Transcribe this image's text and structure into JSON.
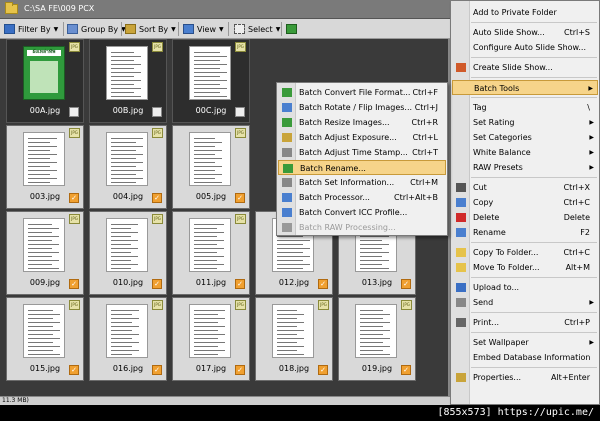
{
  "path": "C:\\SA FE\\009 PCX",
  "toolbar": {
    "filter_by": "Filter By",
    "group_by": "Group By",
    "sort_by": "Sort By",
    "view": "View",
    "select": "Select"
  },
  "thumbnails": [
    {
      "name": "00A.jpg",
      "selected": true,
      "cover": true,
      "checked": false
    },
    {
      "name": "00B.jpg",
      "selected": true,
      "cover": false,
      "checked": false
    },
    {
      "name": "00C.jpg",
      "selected": true,
      "cover": false,
      "checked": false
    },
    {
      "name": "003.jpg",
      "selected": false,
      "cover": false,
      "checked": true
    },
    {
      "name": "004.jpg",
      "selected": false,
      "cover": false,
      "checked": true
    },
    {
      "name": "005.jpg",
      "selected": false,
      "cover": false,
      "checked": true
    },
    {
      "name": "009.jpg",
      "selected": false,
      "cover": false,
      "checked": true
    },
    {
      "name": "010.jpg",
      "selected": false,
      "cover": false,
      "checked": true
    },
    {
      "name": "011.jpg",
      "selected": false,
      "cover": false,
      "checked": true
    },
    {
      "name": "012.jpg",
      "selected": false,
      "cover": false,
      "checked": true
    },
    {
      "name": "013.jpg",
      "selected": false,
      "cover": false,
      "checked": true
    },
    {
      "name": "015.jpg",
      "selected": false,
      "cover": false,
      "checked": true
    },
    {
      "name": "016.jpg",
      "selected": false,
      "cover": false,
      "checked": true
    },
    {
      "name": "017.jpg",
      "selected": false,
      "cover": false,
      "checked": true
    },
    {
      "name": "018.jpg",
      "selected": false,
      "cover": false,
      "checked": true
    },
    {
      "name": "019.jpg",
      "selected": false,
      "cover": false,
      "checked": true
    }
  ],
  "cover_title": "ผังเหล่าทัพ",
  "jpg_badge": "JPG",
  "status": "11.3 MB)",
  "watermark": "[855x573] https://upic.me/",
  "context_menu": [
    {
      "label": "Add to Private Folder",
      "shortcut": "",
      "icon": "",
      "submenu": false,
      "sep_after": true
    },
    {
      "label": "Auto Slide Show...",
      "shortcut": "Ctrl+S",
      "icon": "",
      "submenu": false,
      "sep_after": false
    },
    {
      "label": "Configure Auto Slide Show...",
      "shortcut": "",
      "icon": "",
      "submenu": false,
      "sep_after": true
    },
    {
      "label": "Create Slide Show...",
      "shortcut": "",
      "icon": "slideshow-icon",
      "submenu": false,
      "sep_after": true
    },
    {
      "label": "Batch Tools",
      "shortcut": "",
      "icon": "",
      "submenu": true,
      "sep_after": true,
      "highlight": true
    },
    {
      "label": "Tag",
      "shortcut": "\\",
      "icon": "",
      "submenu": false,
      "sep_after": false
    },
    {
      "label": "Set Rating",
      "shortcut": "",
      "icon": "",
      "submenu": true,
      "sep_after": false
    },
    {
      "label": "Set Categories",
      "shortcut": "",
      "icon": "",
      "submenu": true,
      "sep_after": false
    },
    {
      "label": "White Balance",
      "shortcut": "",
      "icon": "",
      "submenu": true,
      "sep_after": false
    },
    {
      "label": "RAW Presets",
      "shortcut": "",
      "icon": "",
      "submenu": true,
      "sep_after": true
    },
    {
      "label": "Cut",
      "shortcut": "Ctrl+X",
      "icon": "cut-icon",
      "submenu": false,
      "sep_after": false
    },
    {
      "label": "Copy",
      "shortcut": "Ctrl+C",
      "icon": "copy-icon",
      "submenu": false,
      "sep_after": false
    },
    {
      "label": "Delete",
      "shortcut": "Delete",
      "icon": "delete-icon",
      "submenu": false,
      "sep_after": false
    },
    {
      "label": "Rename",
      "shortcut": "F2",
      "icon": "rename-icon",
      "submenu": false,
      "sep_after": true
    },
    {
      "label": "Copy To Folder...",
      "shortcut": "Ctrl+C",
      "icon": "copy-folder-icon",
      "submenu": false,
      "sep_after": false
    },
    {
      "label": "Move To Folder...",
      "shortcut": "Alt+M",
      "icon": "move-folder-icon",
      "submenu": false,
      "sep_after": true
    },
    {
      "label": "Upload to...",
      "shortcut": "",
      "icon": "upload-icon",
      "submenu": false,
      "sep_after": false
    },
    {
      "label": "Send",
      "shortcut": "",
      "icon": "send-icon",
      "submenu": true,
      "sep_after": true
    },
    {
      "label": "Print...",
      "shortcut": "Ctrl+P",
      "icon": "print-icon",
      "submenu": false,
      "sep_after": true
    },
    {
      "label": "Set Wallpaper",
      "shortcut": "",
      "icon": "",
      "submenu": true,
      "sep_after": false
    },
    {
      "label": "Embed Database Information",
      "shortcut": "",
      "icon": "",
      "submenu": false,
      "sep_after": true
    },
    {
      "label": "Properties...",
      "shortcut": "Alt+Enter",
      "icon": "properties-icon",
      "submenu": false,
      "sep_after": false
    }
  ],
  "batch_menu": [
    {
      "label": "Batch Convert File Format...",
      "shortcut": "Ctrl+F",
      "disabled": false,
      "highlight": false
    },
    {
      "label": "Batch Rotate / Flip Images...",
      "shortcut": "Ctrl+J",
      "disabled": false,
      "highlight": false
    },
    {
      "label": "Batch Resize Images...",
      "shortcut": "Ctrl+R",
      "disabled": false,
      "highlight": false
    },
    {
      "label": "Batch Adjust Exposure...",
      "shortcut": "Ctrl+L",
      "disabled": false,
      "highlight": false
    },
    {
      "label": "Batch Adjust Time Stamp...",
      "shortcut": "Ctrl+T",
      "disabled": false,
      "highlight": false
    },
    {
      "label": "Batch Rename...",
      "shortcut": "",
      "disabled": false,
      "highlight": true
    },
    {
      "label": "Batch Set Information...",
      "shortcut": "Ctrl+M",
      "disabled": false,
      "highlight": false
    },
    {
      "label": "Batch Processor...",
      "shortcut": "Ctrl+Alt+B",
      "disabled": false,
      "highlight": false
    },
    {
      "label": "Batch Convert ICC Profile...",
      "shortcut": "",
      "disabled": false,
      "highlight": false
    },
    {
      "label": "Batch RAW Processing...",
      "shortcut": "",
      "disabled": true,
      "highlight": false
    }
  ]
}
